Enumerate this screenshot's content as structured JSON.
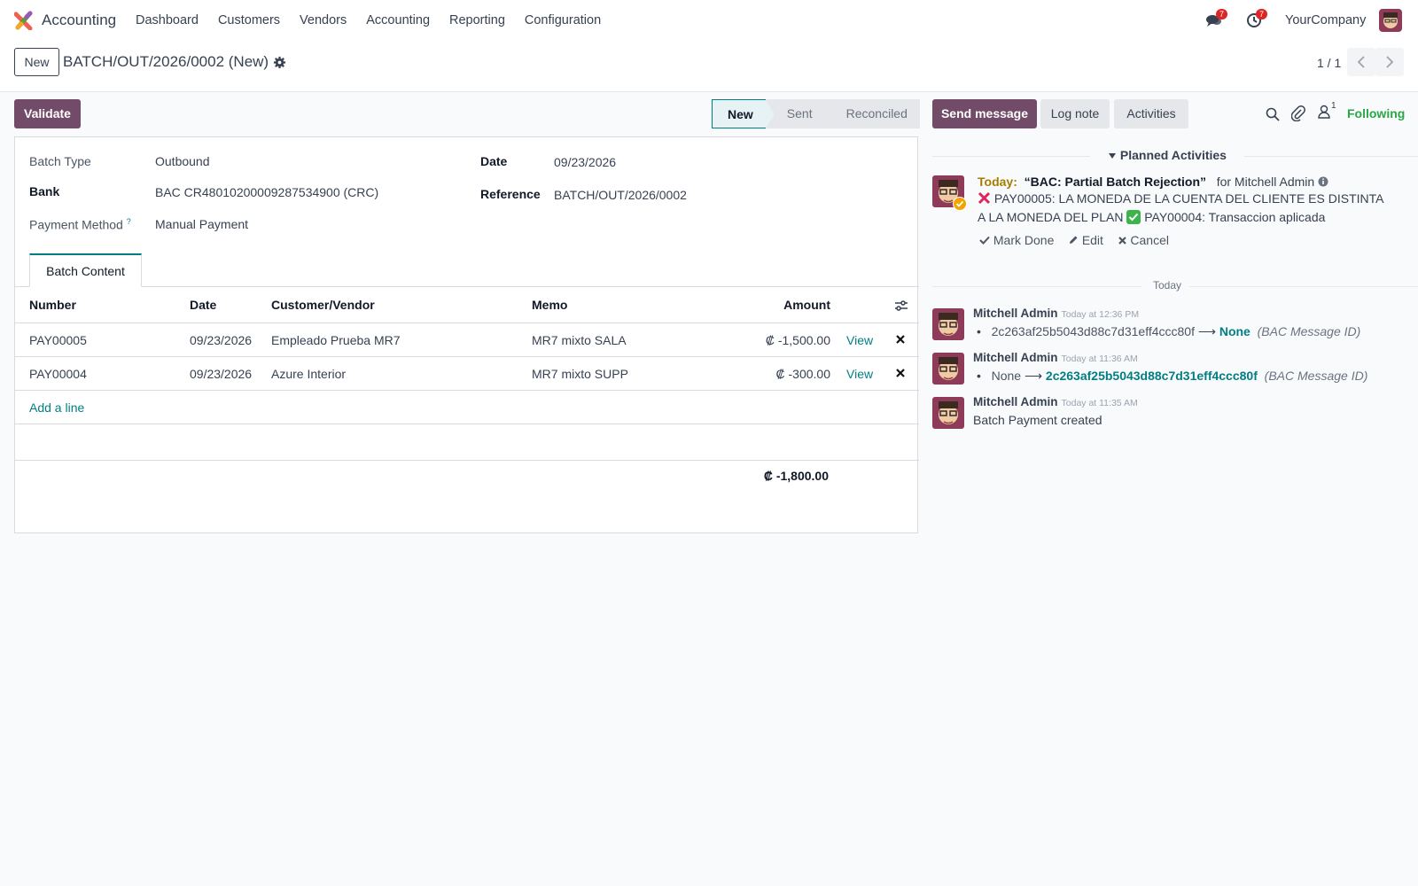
{
  "app": {
    "name": "Accounting"
  },
  "menu": [
    "Dashboard",
    "Customers",
    "Vendors",
    "Accounting",
    "Reporting",
    "Configuration"
  ],
  "systray": {
    "messages_count": "7",
    "activities_count": "7",
    "company": "YourCompany"
  },
  "control": {
    "new_label": "New",
    "record_title": "BATCH/OUT/2026/0002 (New)",
    "pager": "1 / 1"
  },
  "actions": {
    "validate_label": "Validate"
  },
  "status_stages": [
    "New",
    "Sent",
    "Reconciled"
  ],
  "form": {
    "batch_type_label": "Batch Type",
    "batch_type": "Outbound",
    "bank_label": "Bank",
    "bank": "BAC CR48010200009287534900 (CRC)",
    "payment_method_label": "Payment Method",
    "payment_method_help": "?",
    "payment_method": "Manual Payment",
    "date_label": "Date",
    "date": "09/23/2026",
    "reference_label": "Reference",
    "reference": "BATCH/OUT/2026/0002"
  },
  "tabs": {
    "batch_content": "Batch Content"
  },
  "table": {
    "headers": {
      "number": "Number",
      "date": "Date",
      "partner": "Customer/Vendor",
      "memo": "Memo",
      "amount": "Amount"
    },
    "rows": [
      {
        "number": "PAY00005",
        "date": "09/23/2026",
        "partner": "Empleado Prueba MR7",
        "memo": "MR7 mixto SALA",
        "amount": "₡ -1,500.00",
        "view": "View"
      },
      {
        "number": "PAY00004",
        "date": "09/23/2026",
        "partner": "Azure Interior",
        "memo": "MR7 mixto SUPP",
        "amount": "₡ -300.00",
        "view": "View"
      }
    ],
    "add_line": "Add a line",
    "total": "₡ -1,800.00"
  },
  "chatter": {
    "send_message": "Send message",
    "log_note": "Log note",
    "activities": "Activities",
    "followers_count": "1",
    "following": "Following",
    "planned_activities": "Planned Activities",
    "activity": {
      "when": "Today:",
      "title": "“BAC: Partial Batch Rejection”",
      "for": "for Mitchell Admin",
      "line1": "PAY00005: LA MONEDA DE LA CUENTA DEL CLIENTE ES DISTINTA",
      "line2a": "A LA MONEDA DEL PLAN",
      "line2b": "PAY00004: Transaccion aplicada",
      "mark_done": "Mark Done",
      "edit": "Edit",
      "cancel": "Cancel"
    },
    "today_sep": "Today",
    "messages": [
      {
        "author": "Mitchell Admin",
        "time": "Today at 12:36 PM",
        "old": "2c263af25b5043d88c7d31eff4ccc80f",
        "new": "None",
        "field": "(BAC Message ID)"
      },
      {
        "author": "Mitchell Admin",
        "time": "Today at 11:36 AM",
        "old": "None",
        "new": "2c263af25b5043d88c7d31eff4ccc80f",
        "field": "(BAC Message ID)"
      },
      {
        "author": "Mitchell Admin",
        "time": "Today at 11:35 AM",
        "body": "Batch Payment created"
      }
    ]
  }
}
